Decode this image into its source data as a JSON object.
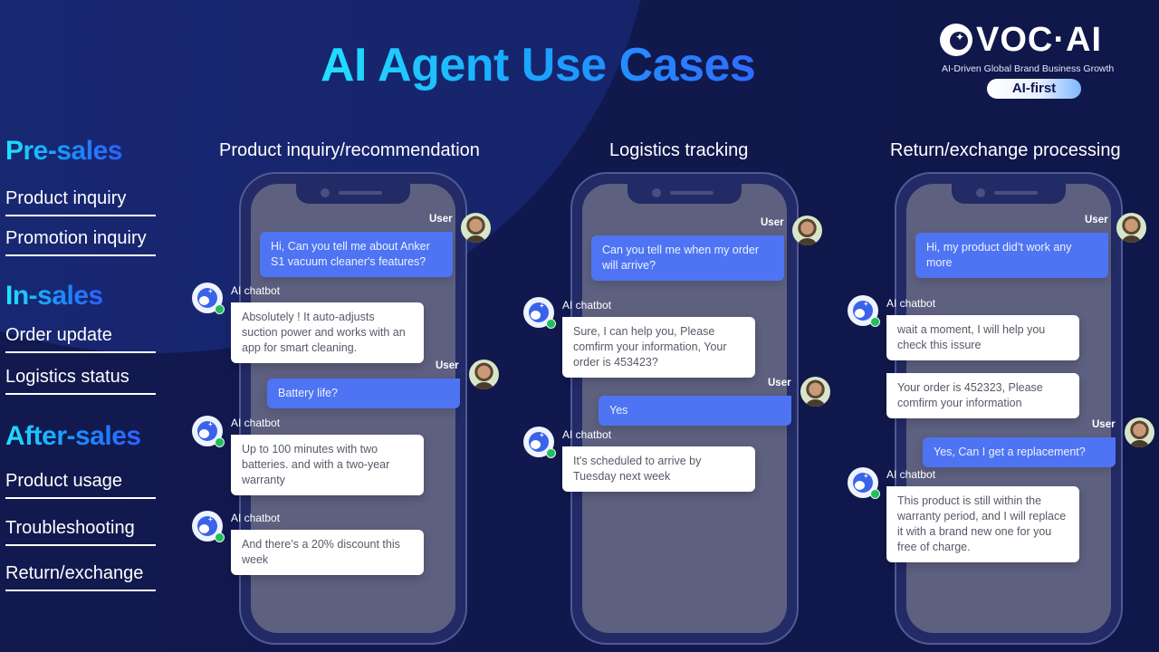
{
  "title": "AI Agent Use Cases",
  "logo": {
    "brand": "VOC·AI",
    "tagline": "AI-Driven Global Brand Business Growth",
    "badge": "AI-first",
    "icon": "moon-star-logo-icon"
  },
  "sidebar": {
    "categories": [
      {
        "label": "Pre-sales",
        "items": [
          "Product inquiry",
          "Promotion inquiry"
        ]
      },
      {
        "label": "In-sales",
        "items": [
          "Order update",
          "Logistics status"
        ]
      },
      {
        "label": "After-sales",
        "items": [
          "Product usage",
          "Troubleshooting",
          "Return/exchange"
        ]
      }
    ]
  },
  "labels": {
    "user": "User",
    "bot": "AI chatbot"
  },
  "columns": [
    {
      "heading": "Product inquiry/recommendation",
      "messages": [
        {
          "role": "user",
          "text": "Hi, Can you tell me about Anker S1 vacuum cleaner's features?"
        },
        {
          "role": "bot",
          "text": "Absolutely ! It auto-adjusts suction power and works with an app for smart cleaning."
        },
        {
          "role": "user",
          "text": "Battery life?"
        },
        {
          "role": "bot",
          "text": "Up to 100 minutes with two batteries. and with a two-year warranty"
        },
        {
          "role": "bot",
          "text": "And there’s a 20% discount this week"
        }
      ]
    },
    {
      "heading": "Logistics tracking",
      "messages": [
        {
          "role": "user",
          "text": "Can you tell me when my order will arrive?"
        },
        {
          "role": "bot",
          "text": "Sure, I can help you, Please comfirm your information, Your order is 453423?"
        },
        {
          "role": "user",
          "text": "Yes"
        },
        {
          "role": "bot",
          "text": "It's scheduled to arrive by Tuesday next week"
        }
      ]
    },
    {
      "heading": "Return/exchange processing",
      "messages": [
        {
          "role": "user",
          "text": "Hi, my product did’t work any more"
        },
        {
          "role": "bot",
          "text": "wait a moment, I will help you check this issure"
        },
        {
          "role": "bot",
          "text": "Your order is 452323, Please comfirm your information"
        },
        {
          "role": "user",
          "text": "Yes, Can I get a replacement?"
        },
        {
          "role": "bot",
          "text": "This product is still within the warranty period, and I will replace it with a brand new one for you free of charge."
        }
      ]
    }
  ],
  "colors": {
    "background": "#12194f",
    "user_bubble": "#4e74f3",
    "bot_bubble": "#ffffff",
    "online_dot": "#1fbf5a",
    "title_gradient_start": "#22e0ff",
    "title_gradient_end": "#2f6cff"
  }
}
